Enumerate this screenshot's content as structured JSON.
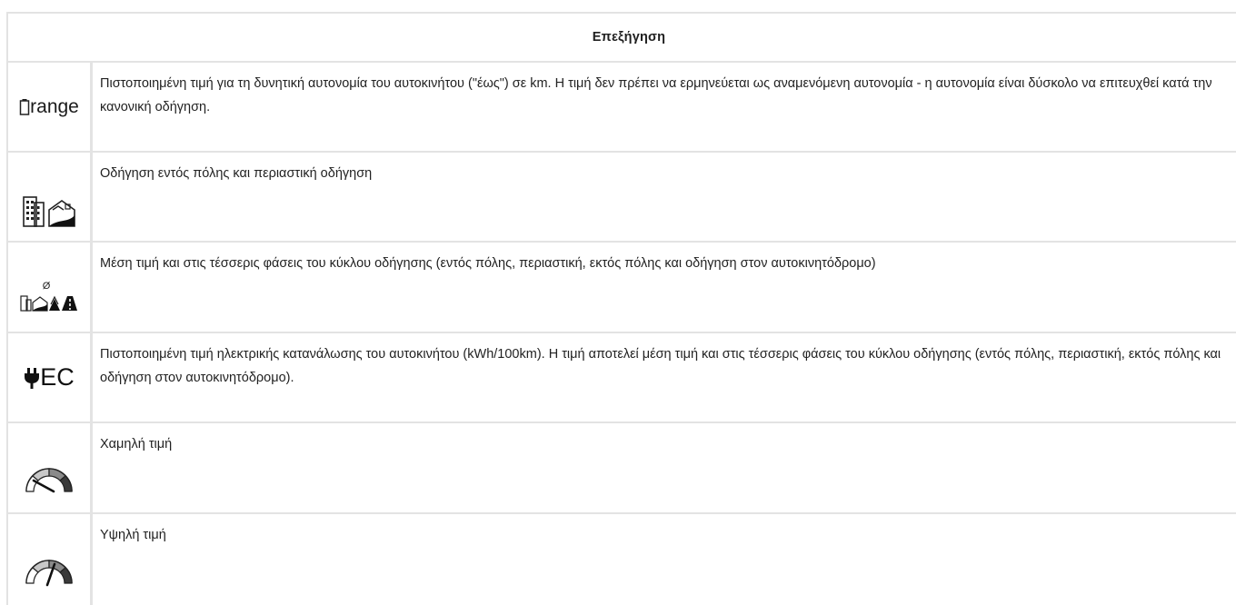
{
  "header": {
    "title": "Επεξήγηση"
  },
  "rows": [
    {
      "icon": "battery-range-icon",
      "icon_text": "range",
      "text": "Πιστοποιημένη τιμή για τη δυνητική αυτονομία του αυτοκινήτου (\"έως\") σε km. Η τιμή δεν πρέπει να ερμηνεύεται ως αναμενόμενη αυτονομία - η αυτονομία είναι δύσκολο να επιτευχθεί κατά την κανονική οδήγηση."
    },
    {
      "icon": "city-suburban-driving-icon",
      "text": "Οδήγηση εντός πόλης και περιαστική οδήγηση"
    },
    {
      "icon": "average-four-phases-icon",
      "icon_text": "Ø",
      "text": "Μέση τιμή και στις τέσσερις φάσεις του κύκλου οδήγησης (εντός πόλης, περιαστική, εκτός πόλης και οδήγηση στον αυτοκινητόδρομο)"
    },
    {
      "icon": "plug-ec-icon",
      "icon_text": "EC",
      "text": "Πιστοποιημένη τιμή ηλεκτρικής κατανάλωσης του αυτοκινήτου (kWh/100km). Η τιμή αποτελεί μέση τιμή και στις τέσσερις φάσεις του κύκλου οδήγησης (εντός πόλης, περιαστική, εκτός πόλης και οδήγηση στον αυτοκινητόδρομο)."
    },
    {
      "icon": "gauge-low-icon",
      "text": "Χαμηλή τιμή"
    },
    {
      "icon": "gauge-high-icon",
      "text": "Υψηλή τιμή"
    }
  ]
}
